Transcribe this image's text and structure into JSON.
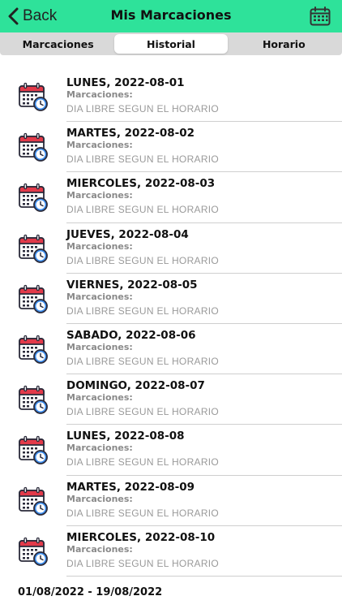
{
  "header": {
    "back_label": "Back",
    "title": "Mis Marcaciones",
    "accent_color": "#2ee29a"
  },
  "tabs": [
    {
      "label": "Marcaciones",
      "active": false
    },
    {
      "label": "Historial",
      "active": true
    },
    {
      "label": "Horario",
      "active": false
    }
  ],
  "entries": [
    {
      "day": "LUNES, 2022-08-01",
      "marks_label": "Marcaciones:",
      "status": "DIA LIBRE SEGUN EL HORARIO"
    },
    {
      "day": "MARTES, 2022-08-02",
      "marks_label": "Marcaciones:",
      "status": "DIA LIBRE SEGUN EL HORARIO"
    },
    {
      "day": "MIERCOLES, 2022-08-03",
      "marks_label": "Marcaciones:",
      "status": "DIA LIBRE SEGUN EL HORARIO"
    },
    {
      "day": "JUEVES, 2022-08-04",
      "marks_label": "Marcaciones:",
      "status": "DIA LIBRE SEGUN EL HORARIO"
    },
    {
      "day": "VIERNES, 2022-08-05",
      "marks_label": "Marcaciones:",
      "status": "DIA LIBRE SEGUN EL HORARIO"
    },
    {
      "day": "SABADO, 2022-08-06",
      "marks_label": "Marcaciones:",
      "status": "DIA LIBRE SEGUN EL HORARIO"
    },
    {
      "day": "DOMINGO, 2022-08-07",
      "marks_label": "Marcaciones:",
      "status": "DIA LIBRE SEGUN EL HORARIO"
    },
    {
      "day": "LUNES, 2022-08-08",
      "marks_label": "Marcaciones:",
      "status": "DIA LIBRE SEGUN EL HORARIO"
    },
    {
      "day": "MARTES, 2022-08-09",
      "marks_label": "Marcaciones:",
      "status": "DIA LIBRE SEGUN EL HORARIO"
    },
    {
      "day": "MIERCOLES, 2022-08-10",
      "marks_label": "Marcaciones:",
      "status": "DIA LIBRE SEGUN EL HORARIO"
    }
  ],
  "entry_icon": "calendar-clock-icon",
  "footer": {
    "range": "01/08/2022 - 19/08/2022"
  }
}
